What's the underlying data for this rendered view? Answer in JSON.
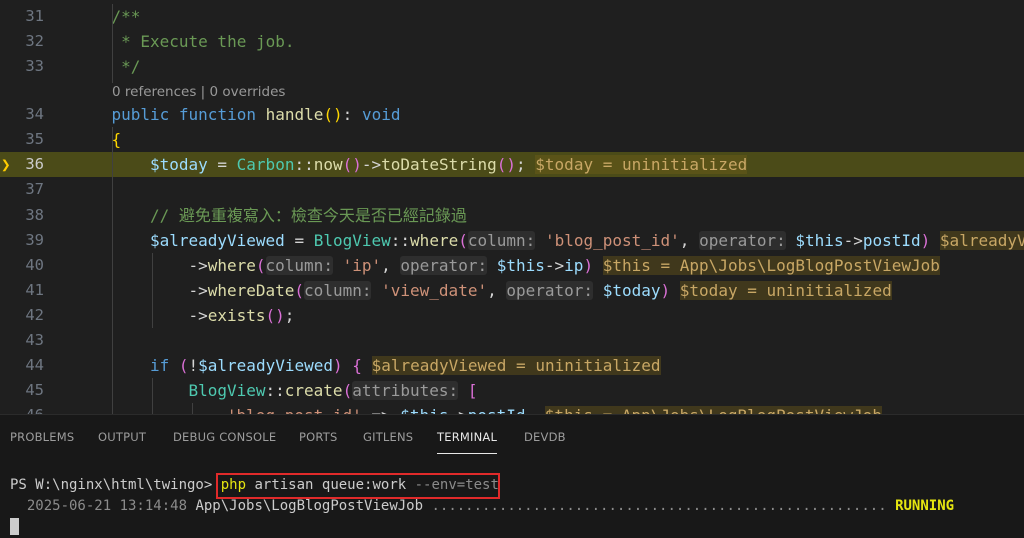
{
  "editor": {
    "lines": [
      {
        "num": "31",
        "indent": 4,
        "segs": [
          {
            "t": "/**",
            "c": "c"
          }
        ]
      },
      {
        "num": "32",
        "indent": 4,
        "segs": [
          {
            "t": " * Execute the job.",
            "c": "c"
          }
        ]
      },
      {
        "num": "33",
        "indent": 4,
        "segs": [
          {
            "t": " */",
            "c": "c"
          }
        ]
      },
      {
        "num": "34",
        "indent": 4,
        "segs": [
          {
            "t": "public",
            "c": "k"
          },
          {
            "t": " ",
            "c": "p"
          },
          {
            "t": "function",
            "c": "k"
          },
          {
            "t": " ",
            "c": "p"
          },
          {
            "t": "handle",
            "c": "fn"
          },
          {
            "t": "()",
            "c": "b1"
          },
          {
            "t": ": ",
            "c": "p"
          },
          {
            "t": "void",
            "c": "k"
          }
        ]
      },
      {
        "num": "35",
        "indent": 4,
        "segs": [
          {
            "t": "{",
            "c": "b1"
          }
        ]
      },
      {
        "num": "36",
        "indent": 8,
        "current": true,
        "segs": [
          {
            "t": "$today",
            "c": "v"
          },
          {
            "t": " = ",
            "c": "p"
          },
          {
            "t": "Carbon",
            "c": "ty"
          },
          {
            "t": "::",
            "c": "p"
          },
          {
            "t": "now",
            "c": "fn"
          },
          {
            "t": "()",
            "c": "b2"
          },
          {
            "t": "->",
            "c": "p"
          },
          {
            "t": "toDateString",
            "c": "fn"
          },
          {
            "t": "()",
            "c": "b2"
          },
          {
            "t": "; ",
            "c": "p"
          },
          {
            "t": "$today = uninitialized",
            "c": "inl"
          }
        ]
      },
      {
        "num": "37",
        "indent": 0,
        "segs": []
      },
      {
        "num": "38",
        "indent": 8,
        "segs": [
          {
            "t": "// 避免重複寫入：檢查今天是否已經記錄過",
            "c": "c"
          }
        ]
      },
      {
        "num": "39",
        "indent": 8,
        "segs": [
          {
            "t": "$alreadyViewed",
            "c": "v"
          },
          {
            "t": " = ",
            "c": "p"
          },
          {
            "t": "BlogView",
            "c": "ty"
          },
          {
            "t": "::",
            "c": "p"
          },
          {
            "t": "where",
            "c": "fn"
          },
          {
            "t": "(",
            "c": "b2"
          },
          {
            "t": "column:",
            "c": "hint"
          },
          {
            "t": " ",
            "c": "p"
          },
          {
            "t": "'blog_post_id'",
            "c": "s"
          },
          {
            "t": ", ",
            "c": "p"
          },
          {
            "t": "operator:",
            "c": "hint"
          },
          {
            "t": " ",
            "c": "p"
          },
          {
            "t": "$this",
            "c": "v"
          },
          {
            "t": "->",
            "c": "p"
          },
          {
            "t": "postId",
            "c": "v"
          },
          {
            "t": ")",
            "c": "b2"
          },
          {
            "t": " ",
            "c": "p"
          },
          {
            "t": "$alreadyViewed = uninitialized",
            "c": "inl"
          }
        ]
      },
      {
        "num": "40",
        "indent": 12,
        "segs": [
          {
            "t": "->",
            "c": "p"
          },
          {
            "t": "where",
            "c": "fn"
          },
          {
            "t": "(",
            "c": "b2"
          },
          {
            "t": "column:",
            "c": "hint"
          },
          {
            "t": " ",
            "c": "p"
          },
          {
            "t": "'ip'",
            "c": "s"
          },
          {
            "t": ", ",
            "c": "p"
          },
          {
            "t": "operator:",
            "c": "hint"
          },
          {
            "t": " ",
            "c": "p"
          },
          {
            "t": "$this",
            "c": "v"
          },
          {
            "t": "->",
            "c": "p"
          },
          {
            "t": "ip",
            "c": "v"
          },
          {
            "t": ")",
            "c": "b2"
          },
          {
            "t": " ",
            "c": "p"
          },
          {
            "t": "$this = App\\Jobs\\LogBlogPostViewJob",
            "c": "inl"
          }
        ]
      },
      {
        "num": "41",
        "indent": 12,
        "segs": [
          {
            "t": "->",
            "c": "p"
          },
          {
            "t": "whereDate",
            "c": "fn"
          },
          {
            "t": "(",
            "c": "b2"
          },
          {
            "t": "column:",
            "c": "hint"
          },
          {
            "t": " ",
            "c": "p"
          },
          {
            "t": "'view_date'",
            "c": "s"
          },
          {
            "t": ", ",
            "c": "p"
          },
          {
            "t": "operator:",
            "c": "hint"
          },
          {
            "t": " ",
            "c": "p"
          },
          {
            "t": "$today",
            "c": "v"
          },
          {
            "t": ")",
            "c": "b2"
          },
          {
            "t": " ",
            "c": "p"
          },
          {
            "t": "$today = uninitialized",
            "c": "inl"
          }
        ]
      },
      {
        "num": "42",
        "indent": 12,
        "segs": [
          {
            "t": "->",
            "c": "p"
          },
          {
            "t": "exists",
            "c": "fn"
          },
          {
            "t": "()",
            "c": "b2"
          },
          {
            "t": ";",
            "c": "p"
          }
        ]
      },
      {
        "num": "43",
        "indent": 0,
        "segs": []
      },
      {
        "num": "44",
        "indent": 8,
        "segs": [
          {
            "t": "if",
            "c": "k"
          },
          {
            "t": " ",
            "c": "p"
          },
          {
            "t": "(",
            "c": "b2"
          },
          {
            "t": "!",
            "c": "p"
          },
          {
            "t": "$alreadyViewed",
            "c": "v"
          },
          {
            "t": ")",
            "c": "b2"
          },
          {
            "t": " ",
            "c": "p"
          },
          {
            "t": "{",
            "c": "b2"
          },
          {
            "t": " ",
            "c": "p"
          },
          {
            "t": "$alreadyViewed = uninitialized",
            "c": "inl"
          }
        ]
      },
      {
        "num": "45",
        "indent": 12,
        "segs": [
          {
            "t": "BlogView",
            "c": "ty"
          },
          {
            "t": "::",
            "c": "p"
          },
          {
            "t": "create",
            "c": "fn"
          },
          {
            "t": "(",
            "c": "b2"
          },
          {
            "t": "attributes:",
            "c": "hint"
          },
          {
            "t": " ",
            "c": "p"
          },
          {
            "t": "[",
            "c": "b2"
          }
        ]
      },
      {
        "num": "46",
        "indent": 16,
        "segs": [
          {
            "t": "'blog_post_id'",
            "c": "s"
          },
          {
            "t": " => ",
            "c": "p"
          },
          {
            "t": "$this",
            "c": "v"
          },
          {
            "t": "->",
            "c": "p"
          },
          {
            "t": "postId",
            "c": "v"
          },
          {
            "t": ", ",
            "c": "p"
          },
          {
            "t": "$this = App\\Jobs\\LogBlogPostViewJob",
            "c": "inl"
          }
        ]
      }
    ],
    "codelens": "0 references | 0 overrides"
  },
  "panel": {
    "tabs": [
      {
        "label": "PROBLEMS",
        "active": false
      },
      {
        "label": "OUTPUT",
        "active": false
      },
      {
        "label": "DEBUG CONSOLE",
        "active": false
      },
      {
        "label": "PORTS",
        "active": false
      },
      {
        "label": "GITLENS",
        "active": false
      },
      {
        "label": "TERMINAL",
        "active": true
      },
      {
        "label": "DEVDB",
        "active": false
      }
    ]
  },
  "terminal": {
    "prompt": "PS W:\\nginx\\html\\twingo>",
    "cmd": "php",
    "args": "artisan queue:work",
    "flag": "--env=test",
    "log_date": "2025-06-21 13:14:48",
    "log_job": "App\\Jobs\\LogBlogPostViewJob",
    "log_dots": "......................................................",
    "log_status": "RUNNING"
  }
}
